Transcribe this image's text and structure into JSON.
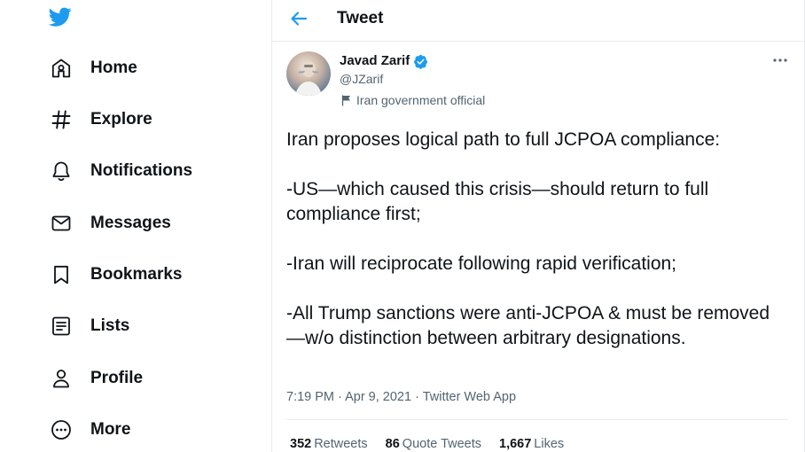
{
  "sidebar": {
    "logo_icon": "twitter-bird-icon",
    "items": [
      {
        "label": "Home",
        "icon": "home-icon"
      },
      {
        "label": "Explore",
        "icon": "hashtag-icon"
      },
      {
        "label": "Notifications",
        "icon": "bell-icon"
      },
      {
        "label": "Messages",
        "icon": "envelope-icon"
      },
      {
        "label": "Bookmarks",
        "icon": "bookmark-icon"
      },
      {
        "label": "Lists",
        "icon": "list-icon"
      },
      {
        "label": "Profile",
        "icon": "person-icon"
      },
      {
        "label": "More",
        "icon": "more-circle-icon"
      }
    ]
  },
  "header": {
    "title": "Tweet",
    "back_icon": "back-arrow-icon"
  },
  "tweet": {
    "author_name": "Javad Zarif",
    "handle": "@JZarif",
    "account_label": "Iran government official",
    "text": "Iran proposes logical path to full JCPOA compliance:\n\n-US—which caused this crisis—should return to full compliance first;\n\n-Iran will reciprocate following rapid verification;\n\n-All Trump sanctions were anti-JCPOA & must be removed—w/o distinction between arbitrary designations.",
    "time": "7:19 PM",
    "separator": " · ",
    "date": "Apr 9, 2021",
    "source": "Twitter Web App",
    "stats": {
      "retweets_count": "352",
      "retweets_label": "Retweets",
      "quotes_count": "86",
      "quotes_label": "Quote Tweets",
      "likes_count": "1,667",
      "likes_label": "Likes"
    }
  },
  "colors": {
    "accent": "#1d9bf0",
    "text": "#0f1419",
    "muted": "#536471",
    "border": "#e6ecf0"
  }
}
